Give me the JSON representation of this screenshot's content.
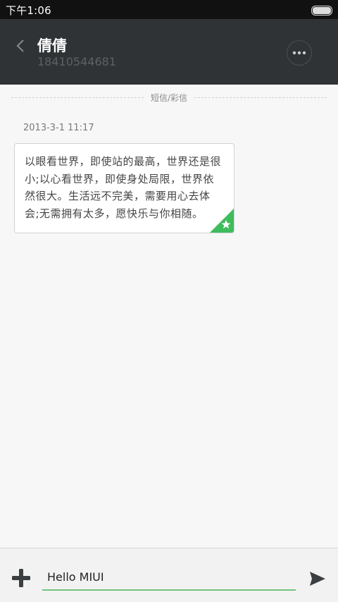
{
  "status_bar": {
    "time": "下午1:06"
  },
  "header": {
    "contact_name": "倩倩",
    "contact_number": "18410544681",
    "more_icon": "more-dots-icon",
    "back_icon": "back-chevron-icon"
  },
  "conversation": {
    "divider_label": "短信/彩信",
    "messages": [
      {
        "timestamp": "2013-3-1 11:17",
        "text": "以眼看世界，即使站的最高，世界还是很小;以心看世界，即使身处局限，世界依然很大。生活远不完美，需要用心去体会;无需拥有太多，愿快乐与你相随。",
        "starred": true
      }
    ]
  },
  "compose": {
    "value": "Hello MIUI",
    "add_icon": "plus-icon",
    "send_icon": "send-icon"
  },
  "colors": {
    "header_bg": "#2f3336",
    "accent_green": "#3fbc5c",
    "input_underline": "#6fc47c"
  }
}
